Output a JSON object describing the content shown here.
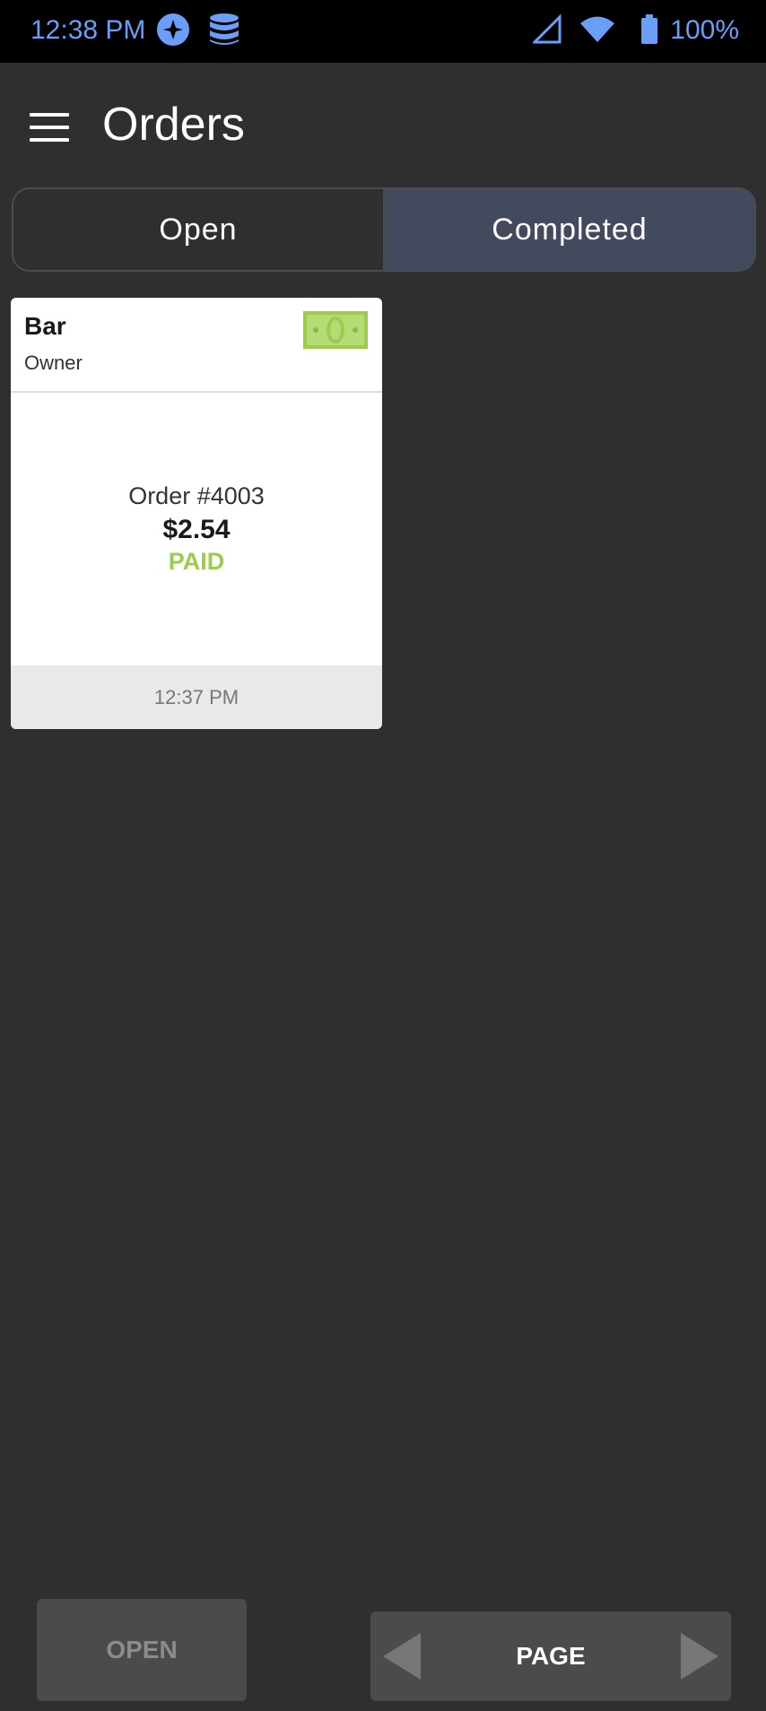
{
  "status_bar": {
    "time": "12:38 PM",
    "battery": "100%",
    "icons": [
      "compass-icon",
      "database-icon",
      "signal-icon",
      "wifi-icon",
      "battery-icon"
    ]
  },
  "header": {
    "title": "Orders",
    "menu_icon": "menu-icon"
  },
  "tabs": {
    "open_label": "Open",
    "completed_label": "Completed",
    "selected": "Completed"
  },
  "orders": [
    {
      "location": "Bar",
      "employee": "Owner",
      "number": "Order #4003",
      "amount": "$2.54",
      "status": "PAID",
      "time": "12:37 PM",
      "payment_icon": "cash-icon"
    }
  ],
  "footer": {
    "open_button": "OPEN",
    "page_label": "PAGE"
  },
  "colors": {
    "background": "#2f2f2f",
    "selected_tab": "#444a5d",
    "paid": "#9ccb4e",
    "status_bar_accent": "#6a9ef7"
  }
}
